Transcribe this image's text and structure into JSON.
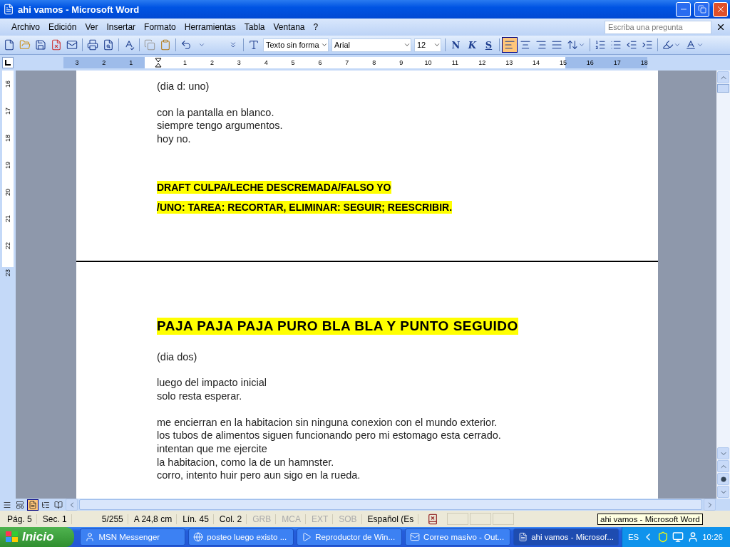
{
  "window": {
    "title": "ahi vamos - Microsoft Word"
  },
  "menu": [
    {
      "label": "Archivo"
    },
    {
      "label": "Edición"
    },
    {
      "label": "Ver"
    },
    {
      "label": "Insertar"
    },
    {
      "label": "Formato"
    },
    {
      "label": "Herramientas"
    },
    {
      "label": "Tabla"
    },
    {
      "label": "Ventana"
    },
    {
      "label": "?"
    }
  ],
  "help_box": {
    "placeholder": "Escriba una pregunta"
  },
  "toolbar": {
    "style": "Texto sin forma",
    "font": "Arial",
    "size": "12",
    "format_buttons": [
      {
        "label": "N",
        "on": false
      },
      {
        "label": "K",
        "on": false
      },
      {
        "label": "S",
        "on": false
      }
    ],
    "align_buttons": [
      {
        "kind": "left",
        "selected": true
      },
      {
        "kind": "center",
        "selected": false
      },
      {
        "kind": "right",
        "selected": false
      },
      {
        "kind": "justify",
        "selected": false
      }
    ]
  },
  "ruler": {
    "left_numbers": [
      "3",
      "2",
      "1"
    ],
    "right_numbers": [
      "1",
      "2",
      "3",
      "4",
      "5",
      "6",
      "7",
      "8",
      "9",
      "10",
      "11",
      "12",
      "13",
      "14",
      "15",
      "16",
      "17",
      "18"
    ]
  },
  "vertical_ruler": [
    "16",
    "17",
    "18",
    "19",
    "20",
    "21",
    "22",
    "23"
  ],
  "pages": [
    {
      "paragraphs": [
        {
          "kind": "text",
          "lines": [
            "(dia d: uno)"
          ]
        },
        {
          "kind": "text",
          "lines": [
            "con la pantalla en blanco.",
            "siempre tengo argumentos.",
            "hoy no."
          ]
        },
        {
          "kind": "highlight",
          "lines": [
            "DRAFT CULPA/LECHE DESCREMADA/FALSO YO",
            "/UNO: TAREA: RECORTAR, ELIMINAR: SEGUIR; REESCRIBIR."
          ]
        }
      ]
    },
    {
      "paragraphs": [
        {
          "kind": "heading",
          "lines": [
            "PAJA PAJA PAJA PURO BLA BLA Y PUNTO SEGUIDO"
          ]
        },
        {
          "kind": "text",
          "lines": [
            "(dia dos)"
          ]
        },
        {
          "kind": "text",
          "lines": [
            "luego del impacto inicial",
            "solo resta esperar."
          ]
        },
        {
          "kind": "text",
          "lines": [
            "me encierran en la habitacion sin ninguna conexion con el mundo exterior.",
            "los tubos de alimentos siguen funcionando pero mi estomago esta cerrado.",
            "intentan que me ejercite",
            "la habitacion, como la de un hamnster.",
            "corro, intento huir pero aun sigo en la rueda."
          ]
        }
      ]
    }
  ],
  "view_buttons": [
    {
      "kind": "normal",
      "selected": false
    },
    {
      "kind": "web",
      "selected": false
    },
    {
      "kind": "print",
      "selected": true
    },
    {
      "kind": "outline",
      "selected": false
    },
    {
      "kind": "reading",
      "selected": false
    }
  ],
  "status_bar": {
    "fields": [
      "Pág. 5",
      "Sec. 1",
      "5/255",
      "A 24,8 cm",
      "Lín. 45",
      "Col. 2"
    ],
    "modes": [
      {
        "label": "GRB",
        "disabled": true
      },
      {
        "label": "MCA",
        "disabled": true
      },
      {
        "label": "EXT",
        "disabled": true
      },
      {
        "label": "SOB",
        "disabled": true
      }
    ],
    "language": "Español (Es"
  },
  "tooltip": "ahi vamos - Microsoft Word",
  "taskbar": {
    "start": "Inicio",
    "tasks": [
      {
        "label": "MSN Messenger",
        "kind": "messenger",
        "selected": false
      },
      {
        "label": "posteo luego existo ...",
        "kind": "browser",
        "selected": false
      },
      {
        "label": "Reproductor de Win...",
        "kind": "media",
        "selected": false
      },
      {
        "label": "Correo masivo - Out...",
        "kind": "mail",
        "selected": false
      },
      {
        "label": "ahi vamos - Microsof...",
        "kind": "word",
        "selected": true
      }
    ],
    "language": "ES",
    "clock": "10:26"
  }
}
